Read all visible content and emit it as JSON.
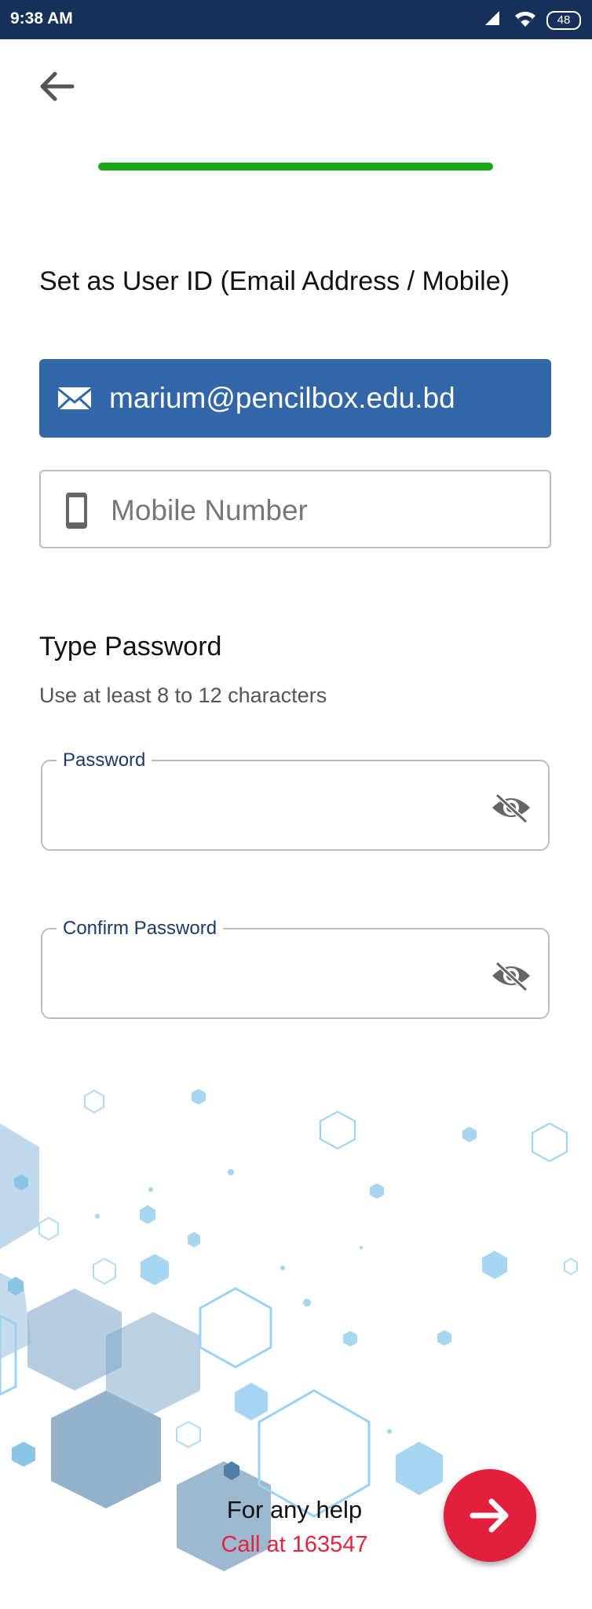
{
  "status_bar": {
    "time": "9:38 AM",
    "battery": "48",
    "icons": [
      "cellular-signal-icon",
      "wifi-icon",
      "battery-icon"
    ]
  },
  "navigation": {
    "back_icon": "arrow-left-icon"
  },
  "progress": {
    "value_fraction": 1.0,
    "color": "#1aa51a"
  },
  "userid": {
    "title": "Set as User ID (Email Address / Mobile)",
    "email_option": {
      "label": "marium@pencilbox.edu.bd",
      "icon": "envelope-icon",
      "selected": true,
      "color": "#3266a9"
    },
    "mobile_option": {
      "placeholder": "Mobile Number",
      "icon": "mobile-phone-icon",
      "selected": false
    }
  },
  "password": {
    "title": "Type Password",
    "hint": "Use at least 8 to 12 characters",
    "password_field": {
      "label": "Password",
      "value": "",
      "icon": "eye-slash-icon"
    },
    "confirm_field": {
      "label": "Confirm Password",
      "value": "",
      "icon": "eye-slash-icon"
    }
  },
  "help": {
    "title": "For any help",
    "phone": "Call at 163547",
    "phone_color": "#e0263e"
  },
  "next_button": {
    "icon": "arrow-right-icon",
    "color": "#e0203d"
  }
}
